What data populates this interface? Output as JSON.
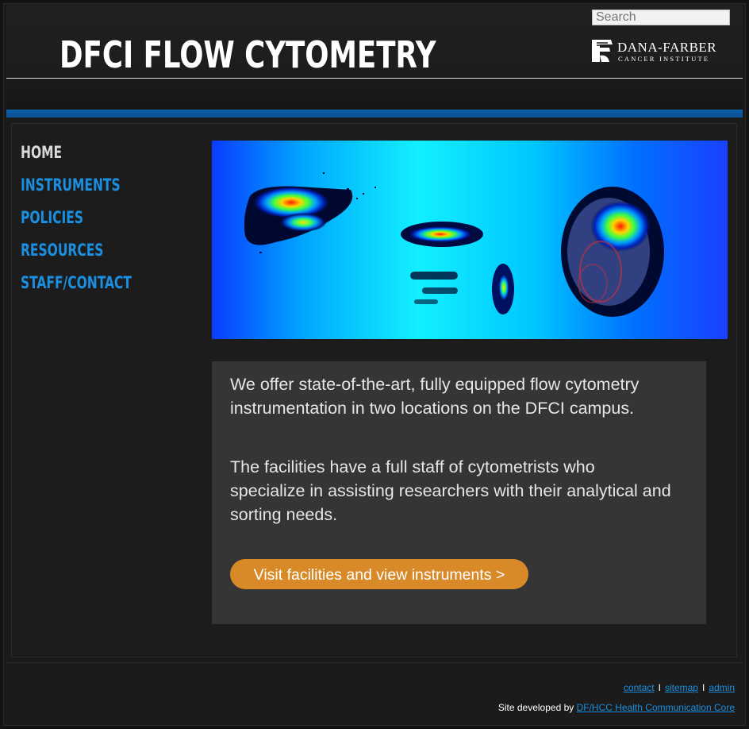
{
  "header": {
    "site_title": "DFCI FLOW CYTOMETRY",
    "search_placeholder": "Search",
    "logo_name": "DANA-FARBER",
    "logo_subtitle": "CANCER INSTITUTE"
  },
  "nav": {
    "items": [
      {
        "label": "HOME",
        "active": true
      },
      {
        "label": "INSTRUMENTS",
        "active": false
      },
      {
        "label": "POLICIES",
        "active": false
      },
      {
        "label": "RESOURCES",
        "active": false
      },
      {
        "label": "STAFF/CONTACT",
        "active": false
      }
    ]
  },
  "hero": {
    "image": "flow-cytometry-density-plots"
  },
  "intro": {
    "paragraph1": "We offer state-of-the-art, fully equipped flow cytometry instrumentation in two locations on the DFCI campus.",
    "paragraph2": "The facilities have a full staff of cytometrists who specialize in assisting researchers with their analytical and sorting needs.",
    "cta_label": "Visit facilities and view instruments >"
  },
  "footer": {
    "links": [
      "contact",
      "sitemap",
      "admin"
    ],
    "separator": "I",
    "credit_prefix": "Site developed by ",
    "credit_link": "DF/HCC Health Communication Core"
  },
  "colors": {
    "accent_blue": "#1a8fe0",
    "bar_blue": "#0f5ea8",
    "cta_orange": "#d98a28",
    "panel_gray": "#353535"
  }
}
